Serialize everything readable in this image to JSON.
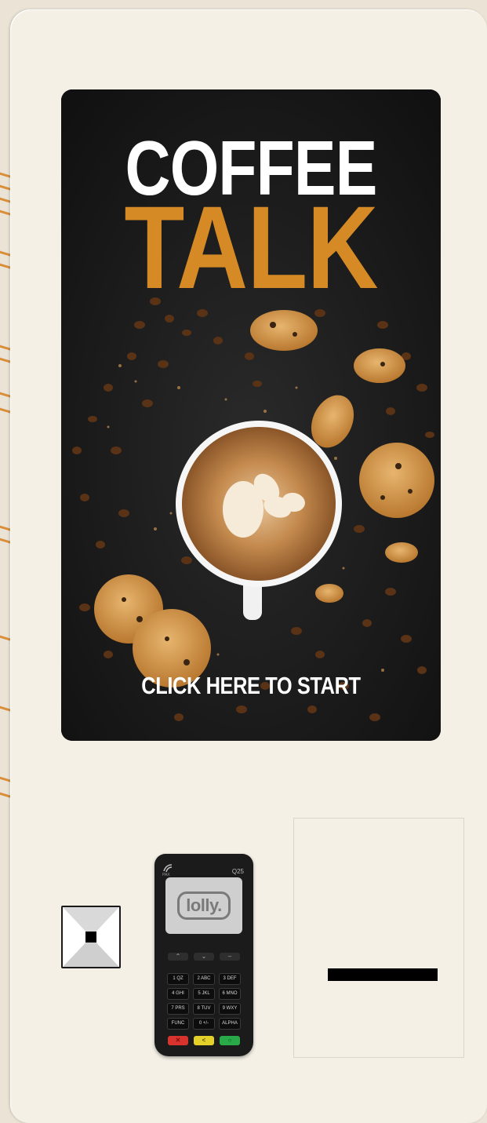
{
  "screen": {
    "headline_line1": "COFFEE",
    "headline_line2": "TALK",
    "cta_label": "CLICK HERE TO START"
  },
  "terminal": {
    "model": "Q25",
    "brand": "PAX",
    "display_logo": "lolly.",
    "keypad": [
      [
        "1 QZ",
        "2 ABC",
        "3 DEF"
      ],
      [
        "4 GHI",
        "5 JKL",
        "6 MNO"
      ],
      [
        "7 PRS",
        "8 TUV",
        "9 WXY"
      ],
      [
        "FUNC",
        "0 +/-",
        "ALPHA"
      ]
    ],
    "function_keys": {
      "cancel": "✕",
      "clear": "<",
      "enter": "○"
    }
  },
  "colors": {
    "kiosk_body": "#f4f0e6",
    "accent_orange": "#d58a25",
    "screen_bg": "#1a1a1a"
  }
}
